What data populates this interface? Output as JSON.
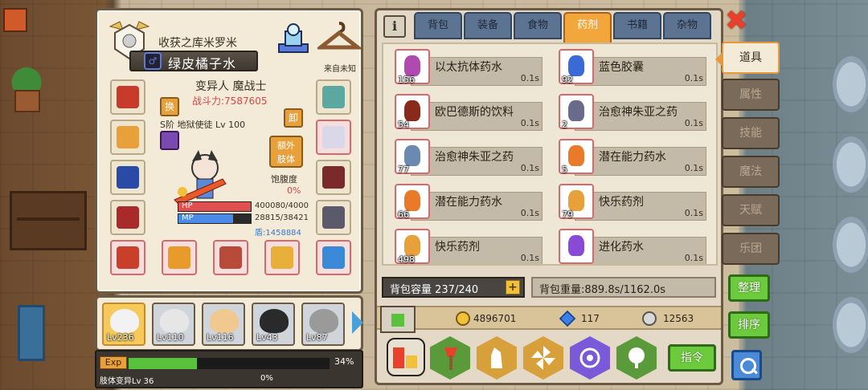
{
  "character": {
    "title": "收获之库米罗米",
    "name": "绿皮橘子水",
    "gender_symbol": "♂",
    "origin": "来自未知",
    "class": "变异人 魔战士",
    "power": "战斗力:7587605",
    "swap_label": "换",
    "unequip_label": "卸",
    "skill_line": "S阶 地狱使徒 Lv 100",
    "extra_limb_label": "额外\n肢体",
    "hunger_label": "饱腹度",
    "hunger_value": "0%",
    "hp_label": "HP",
    "hp_text": "400080/4000",
    "hp_fraction": 1.0,
    "mp_label": "MP",
    "mp_text": "28815/38421",
    "mp_fraction": 0.75,
    "gold_text": "盾:1458884"
  },
  "party": [
    {
      "level": "Lv236",
      "active": true
    },
    {
      "level": "Lv110",
      "active": false
    },
    {
      "level": "Lv116",
      "active": false
    },
    {
      "level": "Lv43",
      "active": false
    },
    {
      "level": "Lv87",
      "active": false
    }
  ],
  "exp": {
    "tag": "Exp",
    "percent_text": "34%",
    "fraction": 0.34,
    "sub_label": "肢体变异Lv 36",
    "sub_percent": "0%"
  },
  "tabs": [
    {
      "label": "背包",
      "active": false
    },
    {
      "label": "装备",
      "active": false
    },
    {
      "label": "食物",
      "active": false
    },
    {
      "label": "药剂",
      "active": true
    },
    {
      "label": "书籍",
      "active": false
    },
    {
      "label": "杂物",
      "active": false
    }
  ],
  "items": [
    {
      "name": "以太抗体药水",
      "qty": "156",
      "time": "0.1s",
      "color": "#b04ab0"
    },
    {
      "name": "蓝色胶囊",
      "qty": "92",
      "time": "0.1s",
      "color": "#3a6ad8"
    },
    {
      "name": "欧巴德斯的饮料",
      "qty": "54",
      "time": "0.1s",
      "color": "#8a2a1a"
    },
    {
      "name": "治愈神朱亚之药",
      "qty": "2",
      "time": "0.1s",
      "color": "#6a6a8a"
    },
    {
      "name": "治愈神朱亚之药",
      "qty": "77",
      "time": "0.1s",
      "color": "#6a8ab0"
    },
    {
      "name": "潜在能力药水",
      "qty": "5",
      "time": "0.1s",
      "color": "#e87a2a"
    },
    {
      "name": "潜在能力药水",
      "qty": "66",
      "time": "0.1s",
      "color": "#e87a2a"
    },
    {
      "name": "快乐药剂",
      "qty": "79",
      "time": "0.1s",
      "color": "#e8a03a"
    },
    {
      "name": "快乐药剂",
      "qty": "498",
      "time": "0.1s",
      "color": "#e8a03a"
    },
    {
      "name": "进化药水",
      "qty": "",
      "time": "0.1s",
      "color": "#8a4ad8"
    }
  ],
  "bag": {
    "capacity": "背包容量 237/240",
    "plus": "+",
    "weight": "背包重量:889.8s/1162.0s"
  },
  "currency": {
    "gold": "4896701",
    "gems": "117",
    "silver": "12563"
  },
  "command_label": "指令",
  "info_label": "i",
  "close_label": "✖",
  "side_tabs": [
    {
      "label": "道具",
      "active": true
    },
    {
      "label": "属性",
      "active": false
    },
    {
      "label": "技能",
      "active": false
    },
    {
      "label": "魔法",
      "active": false
    },
    {
      "label": "天赋",
      "active": false
    },
    {
      "label": "乐团",
      "active": false
    }
  ],
  "organize_label": "整理",
  "sort_label": "排序",
  "colors": {
    "accent_orange": "#f2a63c",
    "tab_blue": "#5c7392",
    "button_green": "#6ccb3c",
    "hp_red": "#e05050",
    "mp_blue": "#4a8ae8"
  }
}
